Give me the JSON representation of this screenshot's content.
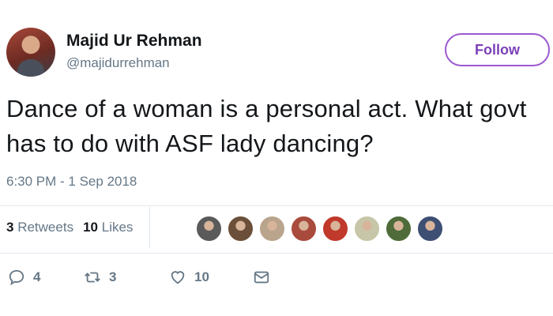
{
  "user": {
    "name": "Majid Ur Rehman",
    "handle": "@majidurrehman"
  },
  "follow_label": "Follow",
  "tweet": {
    "text": "Dance of a woman is a personal act. What govt has to do with ASF lady dancing?",
    "timestamp": "6:30 PM - 1 Sep 2018"
  },
  "stats": {
    "retweets_count": "3",
    "retweets_label": "Retweets",
    "likes_count": "10",
    "likes_label": "Likes"
  },
  "liker_avatars": [
    {
      "color": "#5a5a5a"
    },
    {
      "color": "#6b4f3a"
    },
    {
      "color": "#b9a48c"
    },
    {
      "color": "#a84a3c"
    },
    {
      "color": "#c0392b"
    },
    {
      "color": "#c8c6a8"
    },
    {
      "color": "#4f6b3a"
    },
    {
      "color": "#3d4f73"
    }
  ],
  "actions": {
    "reply_count": "4",
    "retweet_count": "3",
    "like_count": "10"
  },
  "colors": {
    "follow_border": "#9b59d0",
    "follow_text": "#7b3fb8",
    "muted": "#657786"
  }
}
